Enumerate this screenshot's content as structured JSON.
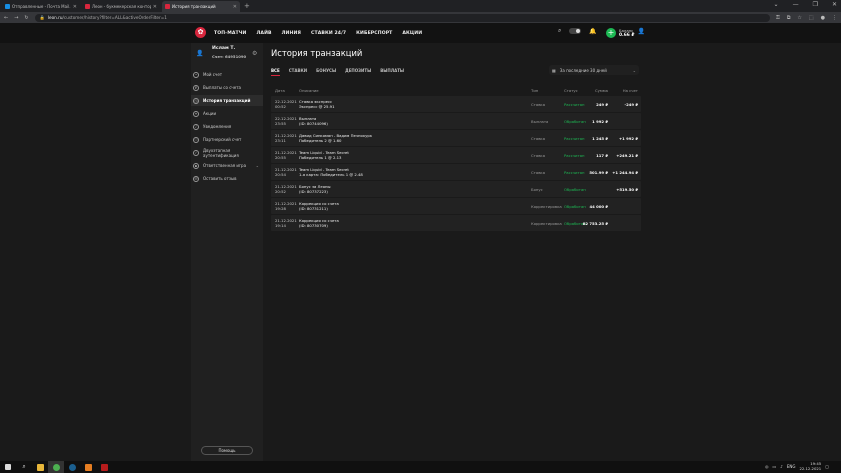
{
  "browser": {
    "tabs": [
      {
        "title": "Отправленные - Почта Mail.ru",
        "color": "#168de2"
      },
      {
        "title": "Леон - букмекерская контор...",
        "color": "#d7263d"
      },
      {
        "title": "История транзакций",
        "color": "#d7263d"
      }
    ],
    "url_domain": "leon.ru",
    "url_path": "/customer/history?filter=ALL&activeOrderFilter=1"
  },
  "nav": {
    "items": [
      "ТОП-МАТЧИ",
      "ЛАЙВ",
      "ЛИНИЯ",
      "СТАВКИ 24/7",
      "КИБЕРСПОРТ",
      "АКЦИИ"
    ],
    "balance_label": "Баланс",
    "balance_value": "0.66 ₽"
  },
  "profile": {
    "name": "Ислам Т.",
    "account": "Счет: 64951090"
  },
  "sidebar": {
    "items": [
      {
        "label": "Мой счет",
        "icon": "user-icon"
      },
      {
        "label": "Выплаты со счета",
        "icon": "wallet-icon"
      },
      {
        "label": "История транзакций",
        "icon": "clock-icon"
      },
      {
        "label": "Акции",
        "icon": "gift-icon"
      },
      {
        "label": "Уведомления",
        "icon": "bell-icon"
      },
      {
        "label": "Партнерский счет",
        "icon": "partner-icon"
      },
      {
        "label": "Двухэтапная аутентификация",
        "icon": "shield-icon"
      },
      {
        "label": "Ответственная игра",
        "icon": "lock-icon"
      },
      {
        "label": "Оставить отзыв",
        "icon": "chat-icon"
      }
    ],
    "help": "Помощь"
  },
  "main": {
    "title": "История транзакций",
    "filter_tabs": [
      "ВСЕ",
      "СТАВКИ",
      "БОНУСЫ",
      "ДЕПОЗИТЫ",
      "ВЫПЛАТЫ"
    ],
    "period": "За последние 30 дней",
    "columns": [
      "Дата",
      "Описание",
      "Тип",
      "Статус",
      "Сумма",
      "На счет"
    ],
    "rows": [
      {
        "date": "22.12.2021",
        "time": "00:52",
        "desc1": "Ставка экспресс",
        "desc2": "Экспресс @ 25.91",
        "type": "Ставка",
        "status": "Рассчитан",
        "sum": "249 ₽",
        "account": "-249 ₽"
      },
      {
        "date": "22.12.2021",
        "time": "23:55",
        "desc1": "Выплата",
        "desc2": "(ID: 80744096)",
        "type": "Выплата",
        "status": "Обработан",
        "sum": "1 992 ₽",
        "account": ""
      },
      {
        "date": "21.12.2021",
        "time": "23:11",
        "desc1": "Давид Синкоман - Вадим Печнокурк",
        "desc2": "Победитель 2 @ 1.60",
        "type": "Ставка",
        "status": "Рассчитан",
        "sum": "1 245 ₽",
        "account": "+1 992 ₽"
      },
      {
        "date": "21.12.2021",
        "time": "20:55",
        "desc1": "Team Liquid - Team Secret",
        "desc2": "Победитель 1 @ 2.13",
        "type": "Ставка",
        "status": "Рассчитан",
        "sum": "117 ₽",
        "account": "+249.21 ₽"
      },
      {
        "date": "21.12.2021",
        "time": "20:54",
        "desc1": "Team Liquid - Team Secret",
        "desc2": "1-я карта: Победитель 1 @ 2.48",
        "type": "Ставка",
        "status": "Рассчитан",
        "sum": "501.99 ₽",
        "account": "+1 244.94 ₽"
      },
      {
        "date": "21.12.2021",
        "time": "20:52",
        "desc1": "Бонус за Леоны",
        "desc2": "(ID: 80737223)",
        "type": "Бонус",
        "status": "Обработан",
        "sum": "",
        "account": "+519.50 ₽"
      },
      {
        "date": "21.12.2021",
        "time": "19:28",
        "desc1": "Коррекция со счета",
        "desc2": "(ID: 80731211)",
        "type": "Корректировка",
        "status": "Обработан",
        "sum": "44 000 ₽",
        "account": ""
      },
      {
        "date": "21.12.2021",
        "time": "19:14",
        "desc1": "Коррекция со счета",
        "desc2": "(ID: 80730709)",
        "type": "Корректировка",
        "status": "Обработан",
        "sum": "82 753.25 ₽",
        "account": ""
      }
    ]
  },
  "taskbar": {
    "lang": "ENG",
    "time": "19:45",
    "date": "22.12.2021"
  },
  "colors": {
    "accent": "#d7263d",
    "success": "#1db954"
  }
}
